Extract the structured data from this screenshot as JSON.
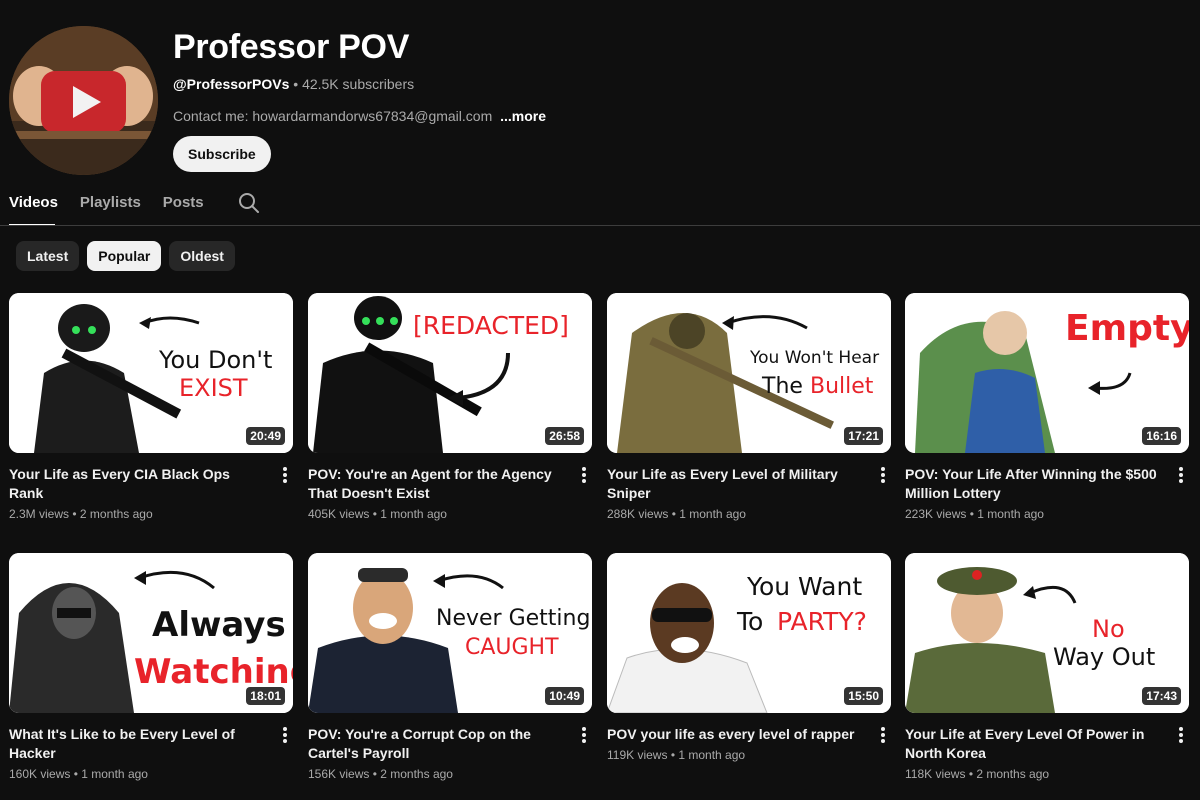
{
  "channel": {
    "name": "Professor POV",
    "handle": "@ProfessorPOVs",
    "subscribers": "42.5K subscribers",
    "separator": " • ",
    "description": "Contact me: howardarmandorws67834@gmail.com",
    "more_label": "...more",
    "subscribe_label": "Subscribe"
  },
  "tabs": [
    {
      "label": "Videos",
      "active": true
    },
    {
      "label": "Playlists",
      "active": false
    },
    {
      "label": "Posts",
      "active": false
    }
  ],
  "search_icon": "search-icon",
  "chips": [
    {
      "label": "Latest",
      "active": false
    },
    {
      "label": "Popular",
      "active": true
    },
    {
      "label": "Oldest",
      "active": false
    }
  ],
  "videos": [
    {
      "title": "Your Life as Every CIA Black Ops Rank",
      "views": "2.3M views",
      "age": "2 months ago",
      "duration": "20:49",
      "thumb_text": [
        "You Don't",
        "EXIST"
      ]
    },
    {
      "title": "POV: You're an Agent for the Agency That Doesn't Exist",
      "views": "405K views",
      "age": "1 month ago",
      "duration": "26:58",
      "thumb_text": [
        "[REDACTED]"
      ]
    },
    {
      "title": "Your Life as Every Level of Military Sniper",
      "views": "288K views",
      "age": "1 month ago",
      "duration": "17:21",
      "thumb_text": [
        "You Won't Hear",
        "The",
        "Bullet"
      ]
    },
    {
      "title": "POV: Your Life After Winning the $500 Million Lottery",
      "views": "223K views",
      "age": "1 month ago",
      "duration": "16:16",
      "thumb_text": [
        "Empty"
      ]
    },
    {
      "title": "What It's Like to be Every Level of Hacker",
      "views": "160K views",
      "age": "1 month ago",
      "duration": "18:01",
      "thumb_text": [
        "Always",
        "Watching"
      ]
    },
    {
      "title": "POV: You're a Corrupt Cop on the Cartel's Payroll",
      "views": "156K views",
      "age": "2 months ago",
      "duration": "10:49",
      "thumb_text": [
        "Never Getting",
        "CAUGHT"
      ]
    },
    {
      "title": "POV your life as every level of rapper",
      "views": "119K views",
      "age": "1 month ago",
      "duration": "15:50",
      "thumb_text": [
        "You Want",
        "To",
        "PARTY?"
      ]
    },
    {
      "title": "Your Life at Every Level Of Power in North Korea",
      "views": "118K views",
      "age": "2 months ago",
      "duration": "17:43",
      "thumb_text": [
        "No",
        "Way Out"
      ]
    }
  ],
  "colors": {
    "background": "#0f0f0f",
    "accent_red": "#e8232a",
    "chip_bg": "#272727",
    "muted_text": "#aaaaaa"
  }
}
